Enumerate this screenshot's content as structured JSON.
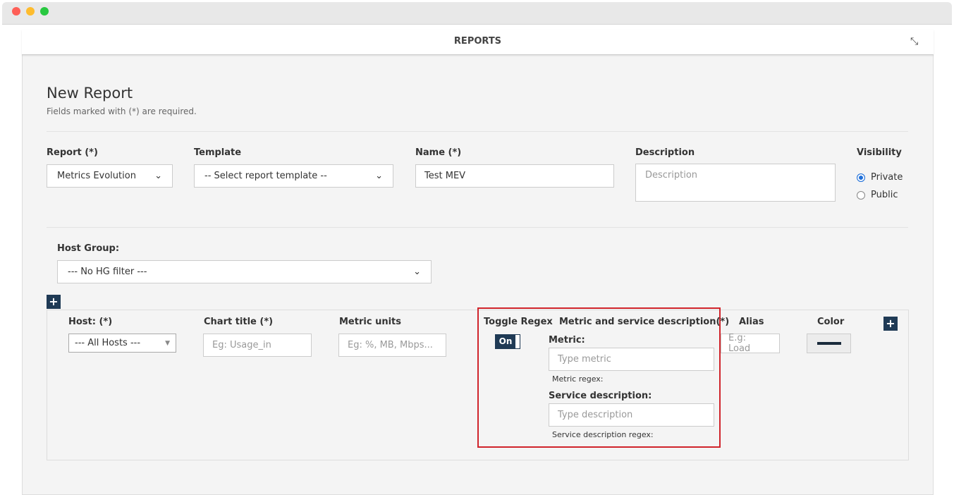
{
  "window": {
    "title": "REPORTS"
  },
  "form": {
    "heading": "New Report",
    "required_note": "Fields marked with (*) are required.",
    "report_label": "Report (*)",
    "report_value": "Metrics Evolution",
    "template_label": "Template",
    "template_value": "-- Select report template --",
    "name_label": "Name (*)",
    "name_value": "Test MEV",
    "description_label": "Description",
    "description_placeholder": "Description",
    "visibility_label": "Visibility",
    "visibility_options": [
      "Private",
      "Public"
    ],
    "visibility_selected": "Private",
    "hostgroup_label": "Host Group:",
    "hostgroup_value": "--- No HG filter ---"
  },
  "row": {
    "host_label": "Host: (*)",
    "host_value": "--- All Hosts ---",
    "chart_title_label": "Chart title (*)",
    "chart_title_placeholder": "Eg: Usage_in",
    "units_label": "Metric units",
    "units_placeholder": "Eg: %, MB, Mbps...",
    "toggle_label": "Toggle Regex",
    "toggle_value": "On",
    "msd_label": "Metric and service description(*)",
    "metric_label": "Metric:",
    "metric_placeholder": "Type metric",
    "metric_regex": "Metric regex:",
    "service_label": "Service description:",
    "service_placeholder": "Type description",
    "service_regex": "Service description regex:",
    "alias_label": "Alias",
    "alias_placeholder": "E.g: Load",
    "color_label": "Color",
    "color_value": "#1a2b3c"
  },
  "colors": {
    "accent": "#1f3a55",
    "highlight": "#d0242b"
  }
}
